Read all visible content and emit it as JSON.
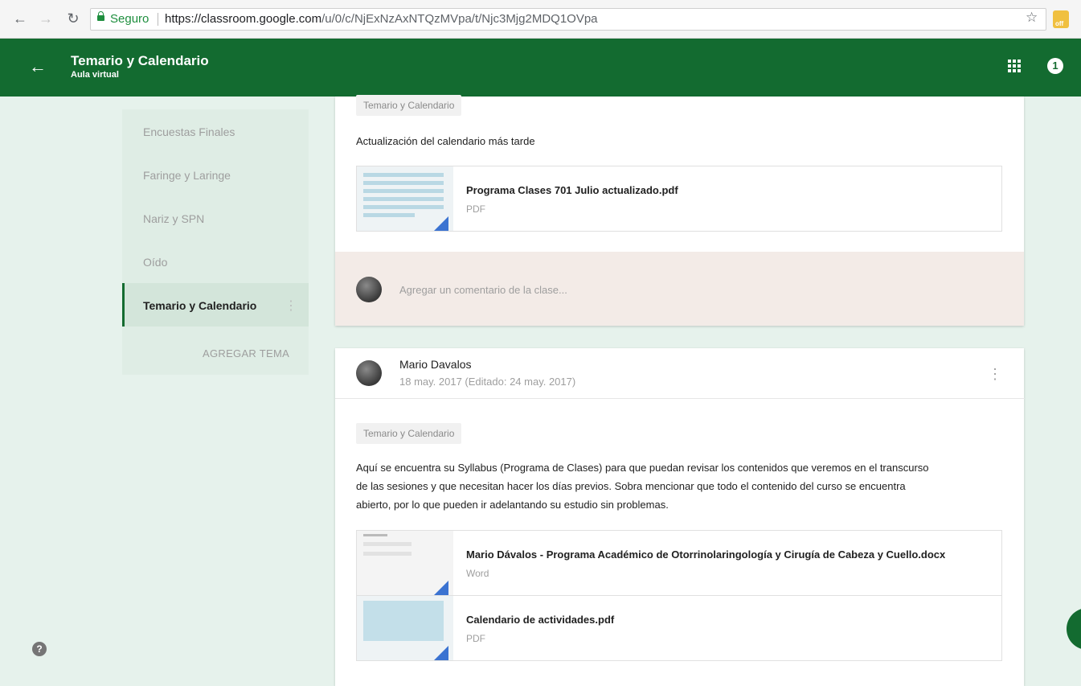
{
  "browser": {
    "secure_label": "Seguro",
    "url_host": "https://classroom.google.com",
    "url_path": "/u/0/c/NjExNzAxNTQzMVpa/t/Njc3Mjg2MDQ1OVpa",
    "back_icon": "arrow-left-icon",
    "reload_icon": "reload-icon"
  },
  "appbar": {
    "title": "Temario y Calendario",
    "subtitle": "Aula virtual",
    "notification_count": "1",
    "color": "#136b30"
  },
  "sidebar": {
    "topics": [
      {
        "label": "Encuestas Finales"
      },
      {
        "label": "Faringe y Laringe"
      },
      {
        "label": "Nariz y SPN"
      },
      {
        "label": "Oído"
      },
      {
        "label": "Temario y Calendario"
      }
    ],
    "add_topic_label": "AGREGAR TEMA"
  },
  "post1": {
    "chip": "Temario y Calendario",
    "text": "Actualización del calendario más tarde",
    "attachment": {
      "title": "Programa Clases 701 Julio actualizado.pdf",
      "type": "PDF"
    },
    "comment_placeholder": "Agregar un comentario de la clase..."
  },
  "post2": {
    "author": "Mario Davalos",
    "date": "18 may. 2017 (Editado: 24 may. 2017)",
    "chip": "Temario y Calendario",
    "text_lines": [
      "Aquí se encuentra su Syllabus (Programa de Clases) para que puedan revisar los contenidos que veremos en el transcurso",
      "de las sesiones y que necesitan hacer los días previos. Sobra mencionar que todo el contenido del curso se encuentra",
      "abierto, por lo que pueden ir adelantando su estudio sin problemas."
    ],
    "attachments": [
      {
        "title": "Mario Dávalos - Programa Académico de Otorrinolaringología y Cirugía de Cabeza y Cuello.docx",
        "type": "Word"
      },
      {
        "title": "Calendario de actividades.pdf",
        "type": "PDF"
      }
    ]
  }
}
